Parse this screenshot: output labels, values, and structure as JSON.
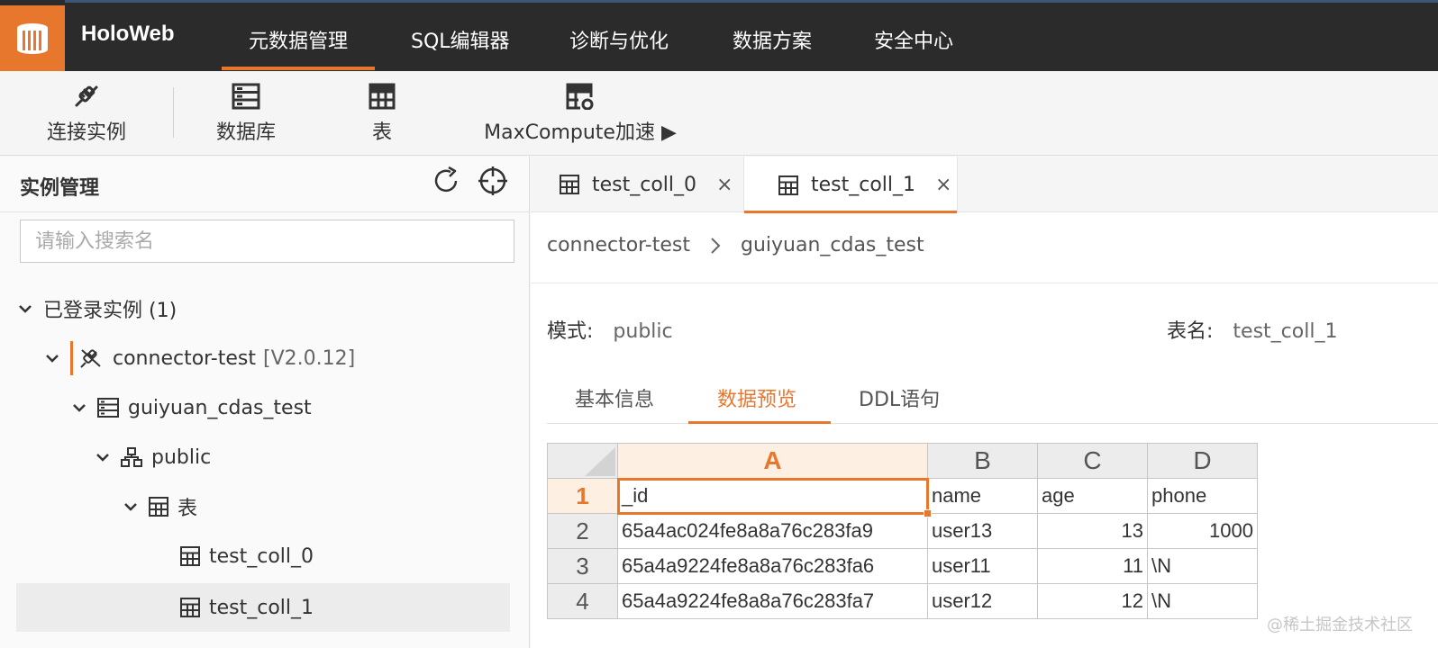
{
  "brand": {
    "name": "HoloWeb",
    "logo_icon": "holoweb-logo-icon",
    "accent": "#e8772e"
  },
  "nav": {
    "items": [
      {
        "label": "元数据管理",
        "active": true
      },
      {
        "label": "SQL编辑器",
        "active": false
      },
      {
        "label": "诊断与优化",
        "active": false
      },
      {
        "label": "数据方案",
        "active": false
      },
      {
        "label": "安全中心",
        "active": false
      }
    ]
  },
  "toolbar": {
    "items": [
      {
        "label": "连接实例",
        "icon": "plug-icon"
      },
      {
        "label": "数据库",
        "icon": "database-icon"
      },
      {
        "label": "表",
        "icon": "table-icon"
      },
      {
        "label": "MaxCompute加速 ▶",
        "icon": "accelerate-table-icon"
      }
    ]
  },
  "left_panel": {
    "title": "实例管理",
    "refresh_icon": "refresh-icon",
    "locate_icon": "locate-icon",
    "search": {
      "placeholder": "请输入搜索名",
      "value": ""
    },
    "tree": {
      "root_label": "已登录实例 (1)",
      "instance": {
        "name": "connector-test",
        "version": "[V2.0.12]"
      },
      "database": "guiyuan_cdas_test",
      "schema": "public",
      "table_folder": "表",
      "tables": [
        "test_coll_0",
        "test_coll_1"
      ],
      "selected_table": "test_coll_1"
    }
  },
  "tabs": [
    {
      "label": "test_coll_0",
      "active": false
    },
    {
      "label": "test_coll_1",
      "active": true
    }
  ],
  "tab_close_glyph": "×",
  "breadcrumb": {
    "instance": "connector-test",
    "database": "guiyuan_cdas_test"
  },
  "meta": {
    "schema_key": "模式:",
    "schema_value": "public",
    "table_key": "表名:",
    "table_value": "test_coll_1"
  },
  "subtabs": [
    {
      "label": "基本信息",
      "active": false
    },
    {
      "label": "数据预览",
      "active": true
    },
    {
      "label": "DDL语句",
      "active": false
    }
  ],
  "grid": {
    "columns": [
      "A",
      "B",
      "C",
      "D"
    ],
    "selected_column": "A",
    "selected_row": "1",
    "rows": [
      {
        "num": "1",
        "cells": [
          "_id",
          "name",
          "age",
          "phone"
        ]
      },
      {
        "num": "2",
        "cells": [
          "65a4ac024fe8a8a76c283fa9",
          "user13",
          "13",
          "1000"
        ]
      },
      {
        "num": "3",
        "cells": [
          "65a4a9224fe8a8a76c283fa6",
          "user11",
          "11",
          "\\N"
        ]
      },
      {
        "num": "4",
        "cells": [
          "65a4a9224fe8a8a76c283fa7",
          "user12",
          "12",
          "\\N"
        ]
      }
    ]
  },
  "watermark": "@稀土掘金技术社区"
}
